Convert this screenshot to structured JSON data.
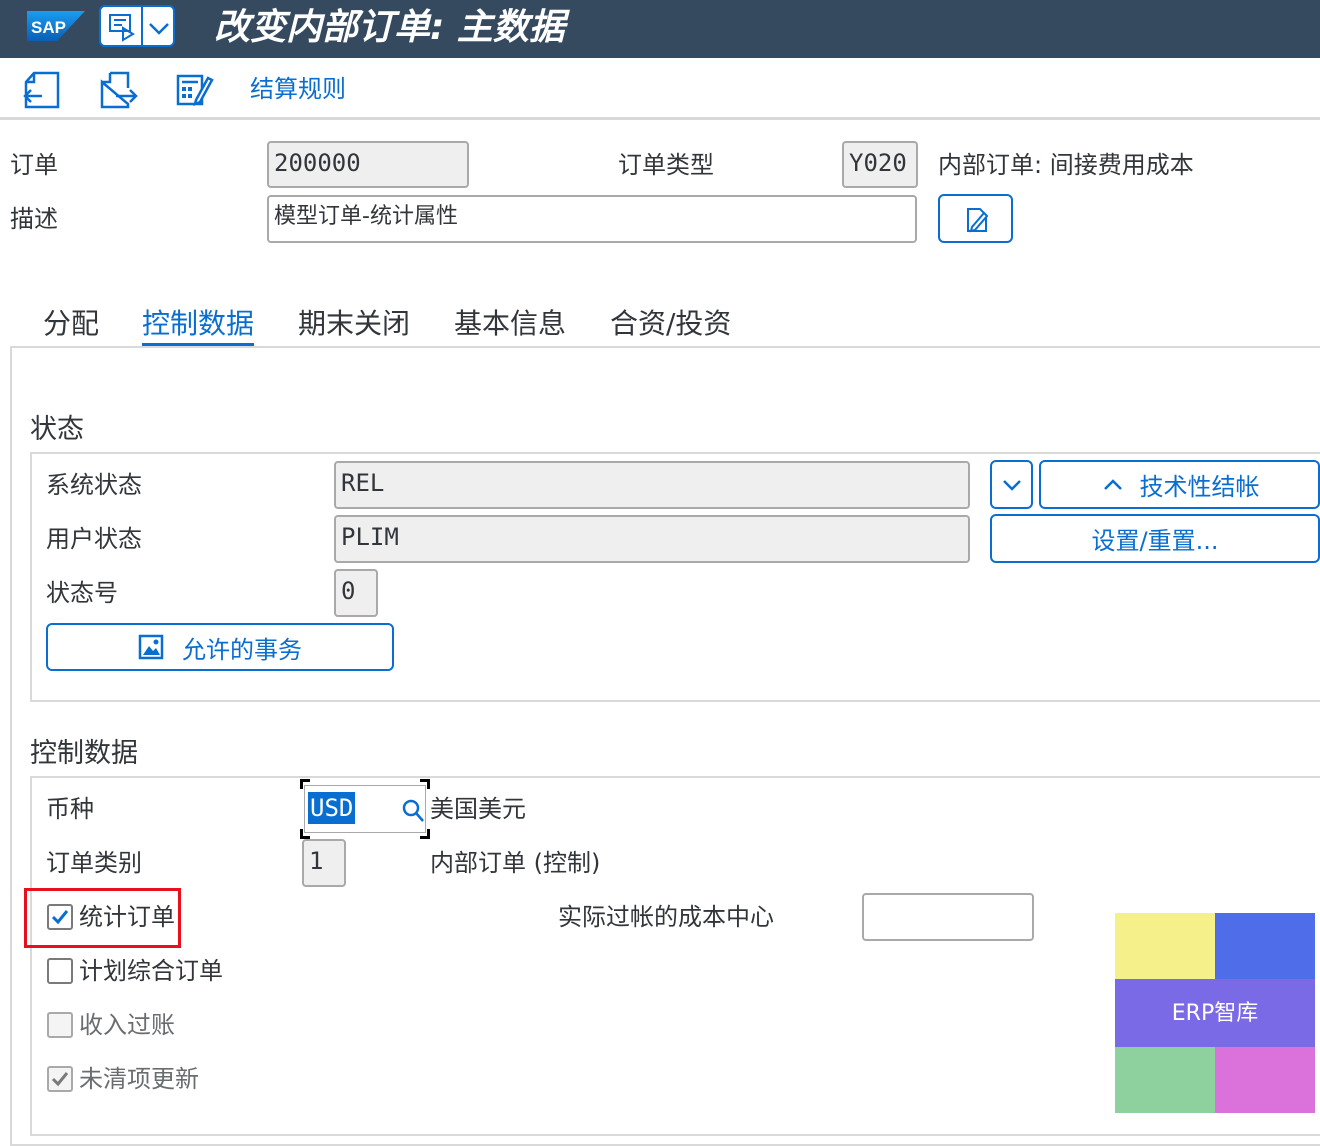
{
  "titlebar": {
    "logo_text": "SAP",
    "title": "改变内部订单: 主数据"
  },
  "toolbar": {
    "settlement_rule_label": "结算规则"
  },
  "header": {
    "order_label": "订单",
    "order_value": "200000",
    "order_type_label": "订单类型",
    "order_type_value": "Y020",
    "order_type_desc": "内部订单: 间接费用成本",
    "description_label": "描述",
    "description_value": "模型订单-统计属性"
  },
  "tabs": [
    {
      "label": "分配",
      "active": false
    },
    {
      "label": "控制数据",
      "active": true
    },
    {
      "label": "期末关闭",
      "active": false
    },
    {
      "label": "基本信息",
      "active": false
    },
    {
      "label": "合资/投资",
      "active": false
    }
  ],
  "status": {
    "section_title": "状态",
    "system_status_label": "系统状态",
    "system_status_value": "REL",
    "user_status_label": "用户状态",
    "user_status_value": "PLIM",
    "status_number_label": "状态号",
    "status_number_value": "0",
    "allowed_transactions_label": "允许的事务",
    "tech_close_label": "技术性结帐",
    "set_reset_label": "设置/重置..."
  },
  "control": {
    "section_title": "控制数据",
    "currency_label": "币种",
    "currency_value": "USD",
    "currency_desc": "美国美元",
    "order_category_label": "订单类别",
    "order_category_value": "1",
    "order_category_desc": "内部订单 (控制)",
    "statistical_order_label": "统计订单",
    "statistical_order_checked": true,
    "plan_integrated_label": "计划综合订单",
    "plan_integrated_checked": false,
    "revenue_posting_label": "收入过账",
    "revenue_posting_checked": false,
    "open_item_update_label": "未清项更新",
    "open_item_update_checked": true,
    "actual_cost_center_label": "实际过帐的成本中心",
    "actual_cost_center_value": ""
  },
  "watermark": {
    "text": "ERP智库",
    "colors": [
      "#f5f08a",
      "#4f6de8",
      "#7b6ae6",
      "#8fd19e",
      "#db72db"
    ]
  }
}
